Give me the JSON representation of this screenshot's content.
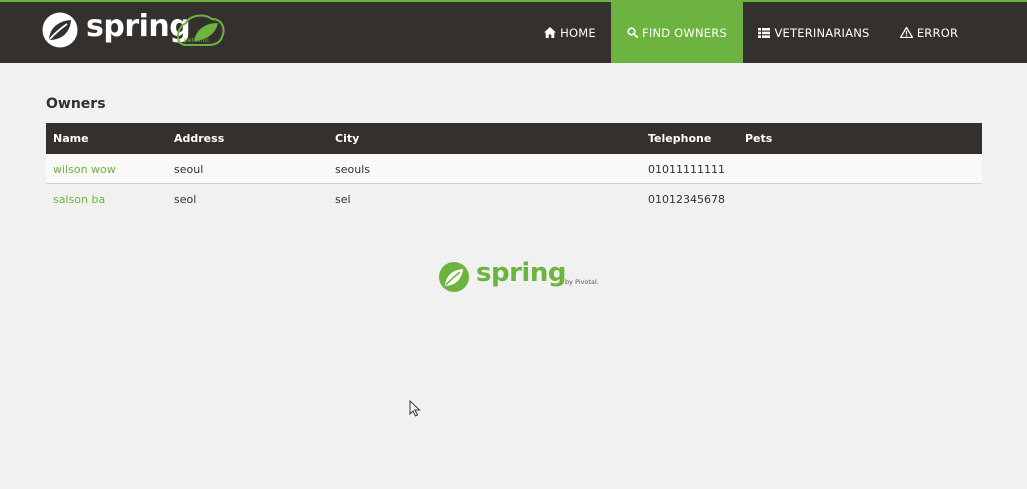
{
  "brand": {
    "name": "spring",
    "badge": "petclinic"
  },
  "nav": {
    "home": "HOME",
    "find_owners": "FIND OWNERS",
    "veterinarians": "VETERINARIANS",
    "error": "ERROR",
    "active_color": "#6db33f",
    "bar_color": "#34302d"
  },
  "page": {
    "title": "Owners"
  },
  "table": {
    "headers": {
      "name": "Name",
      "address": "Address",
      "city": "City",
      "telephone": "Telephone",
      "pets": "Pets"
    },
    "rows": [
      {
        "name": "wilson wow",
        "address": "seoul",
        "city": "seouls",
        "telephone": "01011111111",
        "pets": ""
      },
      {
        "name": "salson ba",
        "address": "seol",
        "city": "sel",
        "telephone": "01012345678",
        "pets": ""
      }
    ]
  },
  "footer": {
    "logo_text": "spring",
    "by_text": "by Pivotal."
  }
}
